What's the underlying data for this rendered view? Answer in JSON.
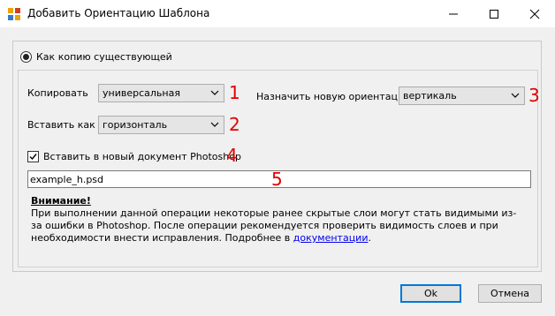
{
  "window": {
    "title": "Добавить Ориентацию Шаблона"
  },
  "mode": {
    "radio_label": "Как копию существующей"
  },
  "copy": {
    "label": "Копировать",
    "value": "универсальная",
    "marker": "1"
  },
  "paste_as": {
    "label": "Вставить как",
    "value": "горизонталь",
    "marker": "2"
  },
  "new_orientation": {
    "label": "Назначить новую ориентацию",
    "value": "вертикаль",
    "marker": "3"
  },
  "new_document": {
    "label": "Вставить в новый документ Photoshop",
    "checked": true,
    "marker": "4"
  },
  "filename": {
    "value": "example_h.psd",
    "marker": "5"
  },
  "warning": {
    "title": "Внимание!",
    "text_before_link": "При выполнении данной операции некоторые ранее скрытые слои могут стать видимыми из-за ошибки в Photoshop. После операции рекомендуется проверить видимость слоев и при необходимости внести исправления. Подробнее в ",
    "link": "документации",
    "text_after_link": "."
  },
  "buttons": {
    "ok": "Ok",
    "cancel": "Отмена"
  },
  "colors": {
    "marker": "#e10000",
    "accent": "#0078d7",
    "link": "#0000ee"
  }
}
